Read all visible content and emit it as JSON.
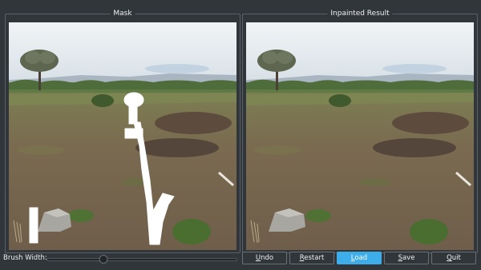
{
  "panels": {
    "mask_title": "Mask",
    "result_title": "Inpainted Result"
  },
  "controls": {
    "brush_label": "Brush Width:",
    "brush_width_fraction": 0.3
  },
  "buttons": [
    {
      "label": "Undo",
      "mnemonic": "U",
      "active": false
    },
    {
      "label": "Restart",
      "mnemonic": "R",
      "active": false
    },
    {
      "label": "Load",
      "mnemonic": "L",
      "active": true
    },
    {
      "label": "Save",
      "mnemonic": "S",
      "active": false
    },
    {
      "label": "Quit",
      "mnemonic": "Q",
      "active": false
    }
  ],
  "colors": {
    "accent": "#3daee9",
    "background": "#31363b",
    "mask": "#ffffff"
  }
}
